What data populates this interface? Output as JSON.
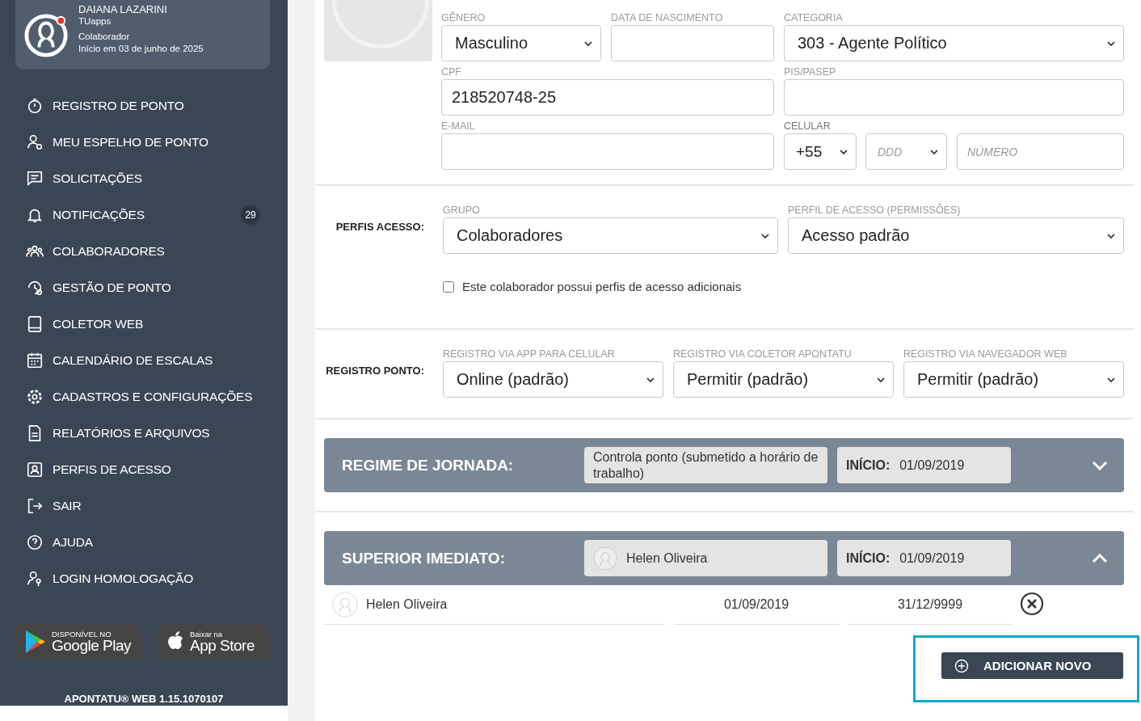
{
  "profile": {
    "name": "DAIANA LAZARINI",
    "company": "TUapps",
    "role": "Colaborador",
    "start": "Início em 03 de junho de 2025",
    "online": true
  },
  "menu": [
    {
      "label": "REGISTRO DE PONTO"
    },
    {
      "label": "MEU ESPELHO DE PONTO"
    },
    {
      "label": "SOLICITAÇÕES"
    },
    {
      "label": "NOTIFICAÇÕES",
      "badge": "29"
    },
    {
      "label": "COLABORADORES"
    },
    {
      "label": "GESTÃO DE PONTO"
    },
    {
      "label": "COLETOR WEB"
    },
    {
      "label": "CALENDÁRIO DE ESCALAS"
    },
    {
      "label": "CADASTROS E CONFIGURAÇÕES"
    },
    {
      "label": "RELATÓRIOS E ARQUIVOS"
    },
    {
      "label": "PERFIS DE ACESSO"
    },
    {
      "label": "SAIR"
    },
    {
      "label": "AJUDA"
    },
    {
      "label": "LOGIN HOMOLOGAÇÃO"
    }
  ],
  "stores": [
    {
      "kind": "google",
      "small": "DISPONÍVEL NO",
      "big": "Google Play"
    },
    {
      "kind": "apple",
      "small": "Baixar na",
      "big": "App Store"
    }
  ],
  "version": "APONTATU® WEB 1.15.1070107",
  "personal": {
    "gender": {
      "label": "GÊNERO",
      "value": "Masculino"
    },
    "birth": {
      "label": "DATA DE NASCIMENTO"
    },
    "category": {
      "label": "CATEGORIA",
      "value": "303 - Agente Político"
    },
    "cpf": {
      "label": "CPF",
      "value": "218520748-25"
    },
    "pis": {
      "label": "PIS/PASEP"
    },
    "email": {
      "label": "E-MAIL"
    },
    "phone": {
      "label": "CELULAR",
      "country": "+55",
      "ddd_placeholder": "DDD",
      "number_placeholder": "NÚMERO"
    }
  },
  "access": {
    "title": "PERFIS ACESSO:",
    "group": {
      "label": "GRUPO",
      "value": "Colaboradores"
    },
    "profile": {
      "label": "PERFIL DE ACESSO (PERMISSÕES)",
      "value": "Acesso padrão"
    },
    "extra": {
      "label": "Este colaborador possui perfis de acesso adicionais",
      "checked": false
    }
  },
  "registro": {
    "title": "REGISTRO PONTO:",
    "fields": [
      {
        "label": "REGISTRO VIA APP PARA CELULAR",
        "value": "Online (padrão)"
      },
      {
        "label": "REGISTRO VIA COLETOR APONTATU",
        "value": "Permitir (padrão)"
      },
      {
        "label": "REGISTRO VIA NAVEGADOR WEB",
        "value": "Permitir (padrão)"
      }
    ]
  },
  "regime": {
    "title": "REGIME DE JORNADA:",
    "value": "Controla ponto (submetido a horário de trabalho)",
    "start_label": "INÍCIO:",
    "start": "01/09/2019",
    "expanded": false
  },
  "superior": {
    "title": "SUPERIOR IMEDIATO:",
    "value": "Helen Oliveira",
    "start_label": "INÍCIO:",
    "start": "01/09/2019",
    "expanded": true,
    "rows": [
      {
        "name": "Helen Oliveira",
        "start": "01/09/2019",
        "end": "31/12/9999"
      }
    ]
  },
  "add_button": "ADICIONAR NOVO"
}
